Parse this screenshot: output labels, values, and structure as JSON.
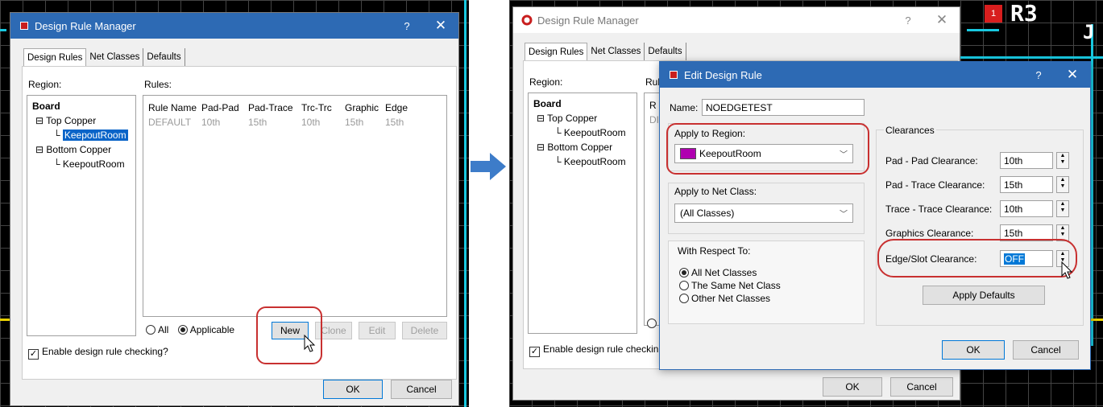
{
  "colors": {
    "title_active": "#2d6ab4",
    "callout": "#c83030",
    "keepout": "#b000b0",
    "arrow": "#3d7cc9"
  },
  "pcb_labels": {
    "pad_number": "1",
    "ref": "R3",
    "ref2": "J"
  },
  "left": {
    "title": "Design Rule Manager",
    "help": "?",
    "close": "✕",
    "tabs": [
      "Design Rules",
      "Net Classes",
      "Defaults"
    ],
    "region_label": "Region:",
    "rules_label": "Rules:",
    "tree": {
      "board": "Board",
      "top": "Top Copper",
      "top_child": "KeepoutRoom",
      "bottom": "Bottom Copper",
      "bottom_child": "KeepoutRoom"
    },
    "columns": [
      "Rule Name",
      "Pad-Pad",
      "Pad-Trace",
      "Trc-Trc",
      "Graphic",
      "Edge"
    ],
    "row": [
      "DEFAULT",
      "10th",
      "15th",
      "10th",
      "15th",
      "15th"
    ],
    "radio_all": "All",
    "radio_applicable": "Applicable",
    "btn_new": "New",
    "btn_clone": "Clone",
    "btn_edit": "Edit",
    "btn_delete": "Delete",
    "enable_drc": "Enable design rule checking?",
    "ok": "OK",
    "cancel": "Cancel"
  },
  "right_bg": {
    "title": "Design Rule Manager",
    "help": "?",
    "close": "✕",
    "tabs": [
      "Design Rules",
      "Net Classes",
      "Defaults"
    ],
    "region_label": "Region:",
    "rules_label": "Rul",
    "tree": {
      "board": "Board",
      "top": "Top Copper",
      "top_child": "KeepoutRoom",
      "bottom": "Bottom Copper",
      "bottom_child": "KeepoutRoom"
    },
    "col_stub": "R",
    "row_stub": "DI",
    "radio_stub": "",
    "enable_drc": "Enable design rule checkin",
    "ok": "OK",
    "cancel": "Cancel"
  },
  "edit": {
    "title": "Edit Design Rule",
    "help": "?",
    "close": "✕",
    "name_label": "Name:",
    "name_value": "NOEDGETEST",
    "apply_region_label": "Apply to Region:",
    "region_value": "KeepoutRoom",
    "apply_net_label": "Apply to Net Class:",
    "net_value": "(All Classes)",
    "respect_label": "With Respect To:",
    "respect_options": [
      "All Net Classes",
      "The Same Net Class",
      "Other Net Classes"
    ],
    "clearances_label": "Clearances",
    "clearances": [
      {
        "label": "Pad - Pad Clearance:",
        "value": "10th"
      },
      {
        "label": "Pad - Trace Clearance:",
        "value": "15th"
      },
      {
        "label": "Trace - Trace Clearance:",
        "value": "10th"
      },
      {
        "label": "Graphics Clearance:",
        "value": "15th"
      },
      {
        "label": "Edge/Slot Clearance:",
        "value": "OFF"
      }
    ],
    "apply_defaults": "Apply Defaults",
    "ok": "OK",
    "cancel": "Cancel"
  }
}
